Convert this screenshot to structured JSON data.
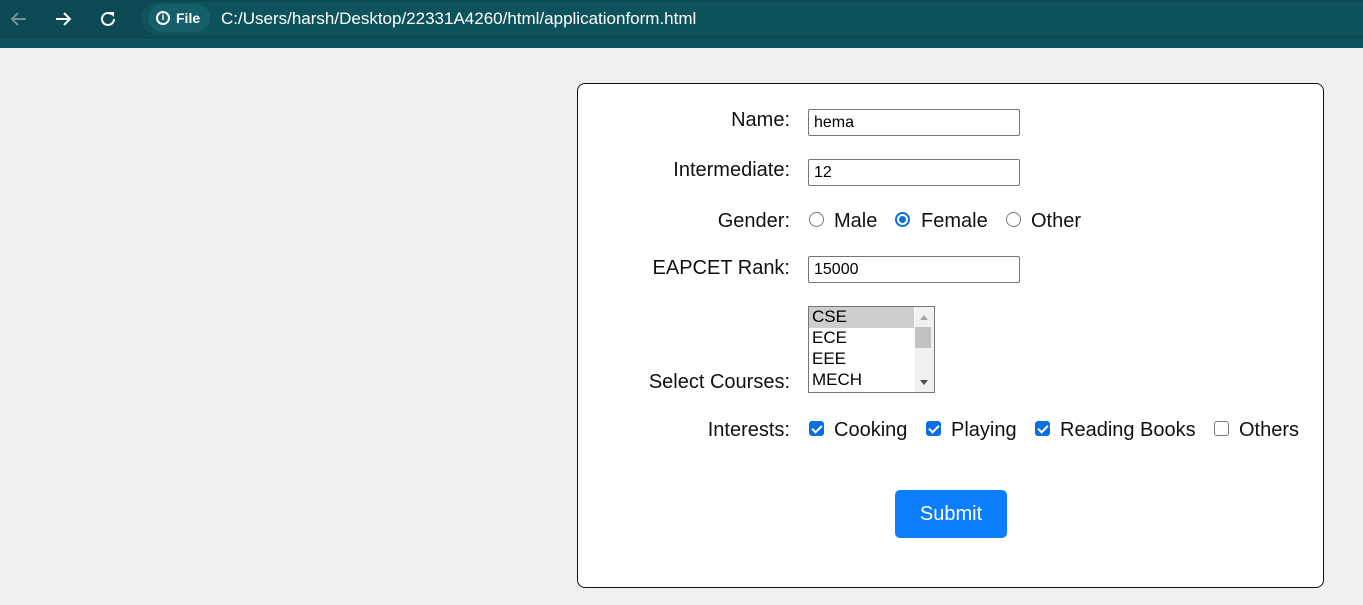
{
  "browser": {
    "back_icon": "arrow-left-icon",
    "forward_icon": "arrow-right-icon",
    "reload_icon": "reload-icon",
    "info_icon": "info-icon",
    "site_chip_label": "File",
    "url": "C:/Users/harsh/Desktop/22331A4260/html/applicationform.html"
  },
  "form": {
    "name_label": "Name:",
    "name_value": "hema",
    "intermediate_label": "Intermediate:",
    "intermediate_value": "12",
    "gender_label": "Gender:",
    "gender_options": [
      "Male",
      "Female",
      "Other"
    ],
    "gender_selected": "Female",
    "rank_label": "EAPCET Rank:",
    "rank_value": "15000",
    "courses_label": "Select Courses:",
    "courses_options": [
      "CSE",
      "ECE",
      "EEE",
      "MECH"
    ],
    "courses_selected": "CSE",
    "interests_label": "Interests:",
    "interests": [
      {
        "label": "Cooking",
        "checked": true
      },
      {
        "label": "Playing",
        "checked": true
      },
      {
        "label": "Reading Books",
        "checked": true
      },
      {
        "label": "Others",
        "checked": false
      }
    ],
    "submit_label": "Submit"
  },
  "colors": {
    "chrome_bg": "#0b4a52",
    "accent": "#0b7dff",
    "page_bg": "#f0f0f0"
  }
}
